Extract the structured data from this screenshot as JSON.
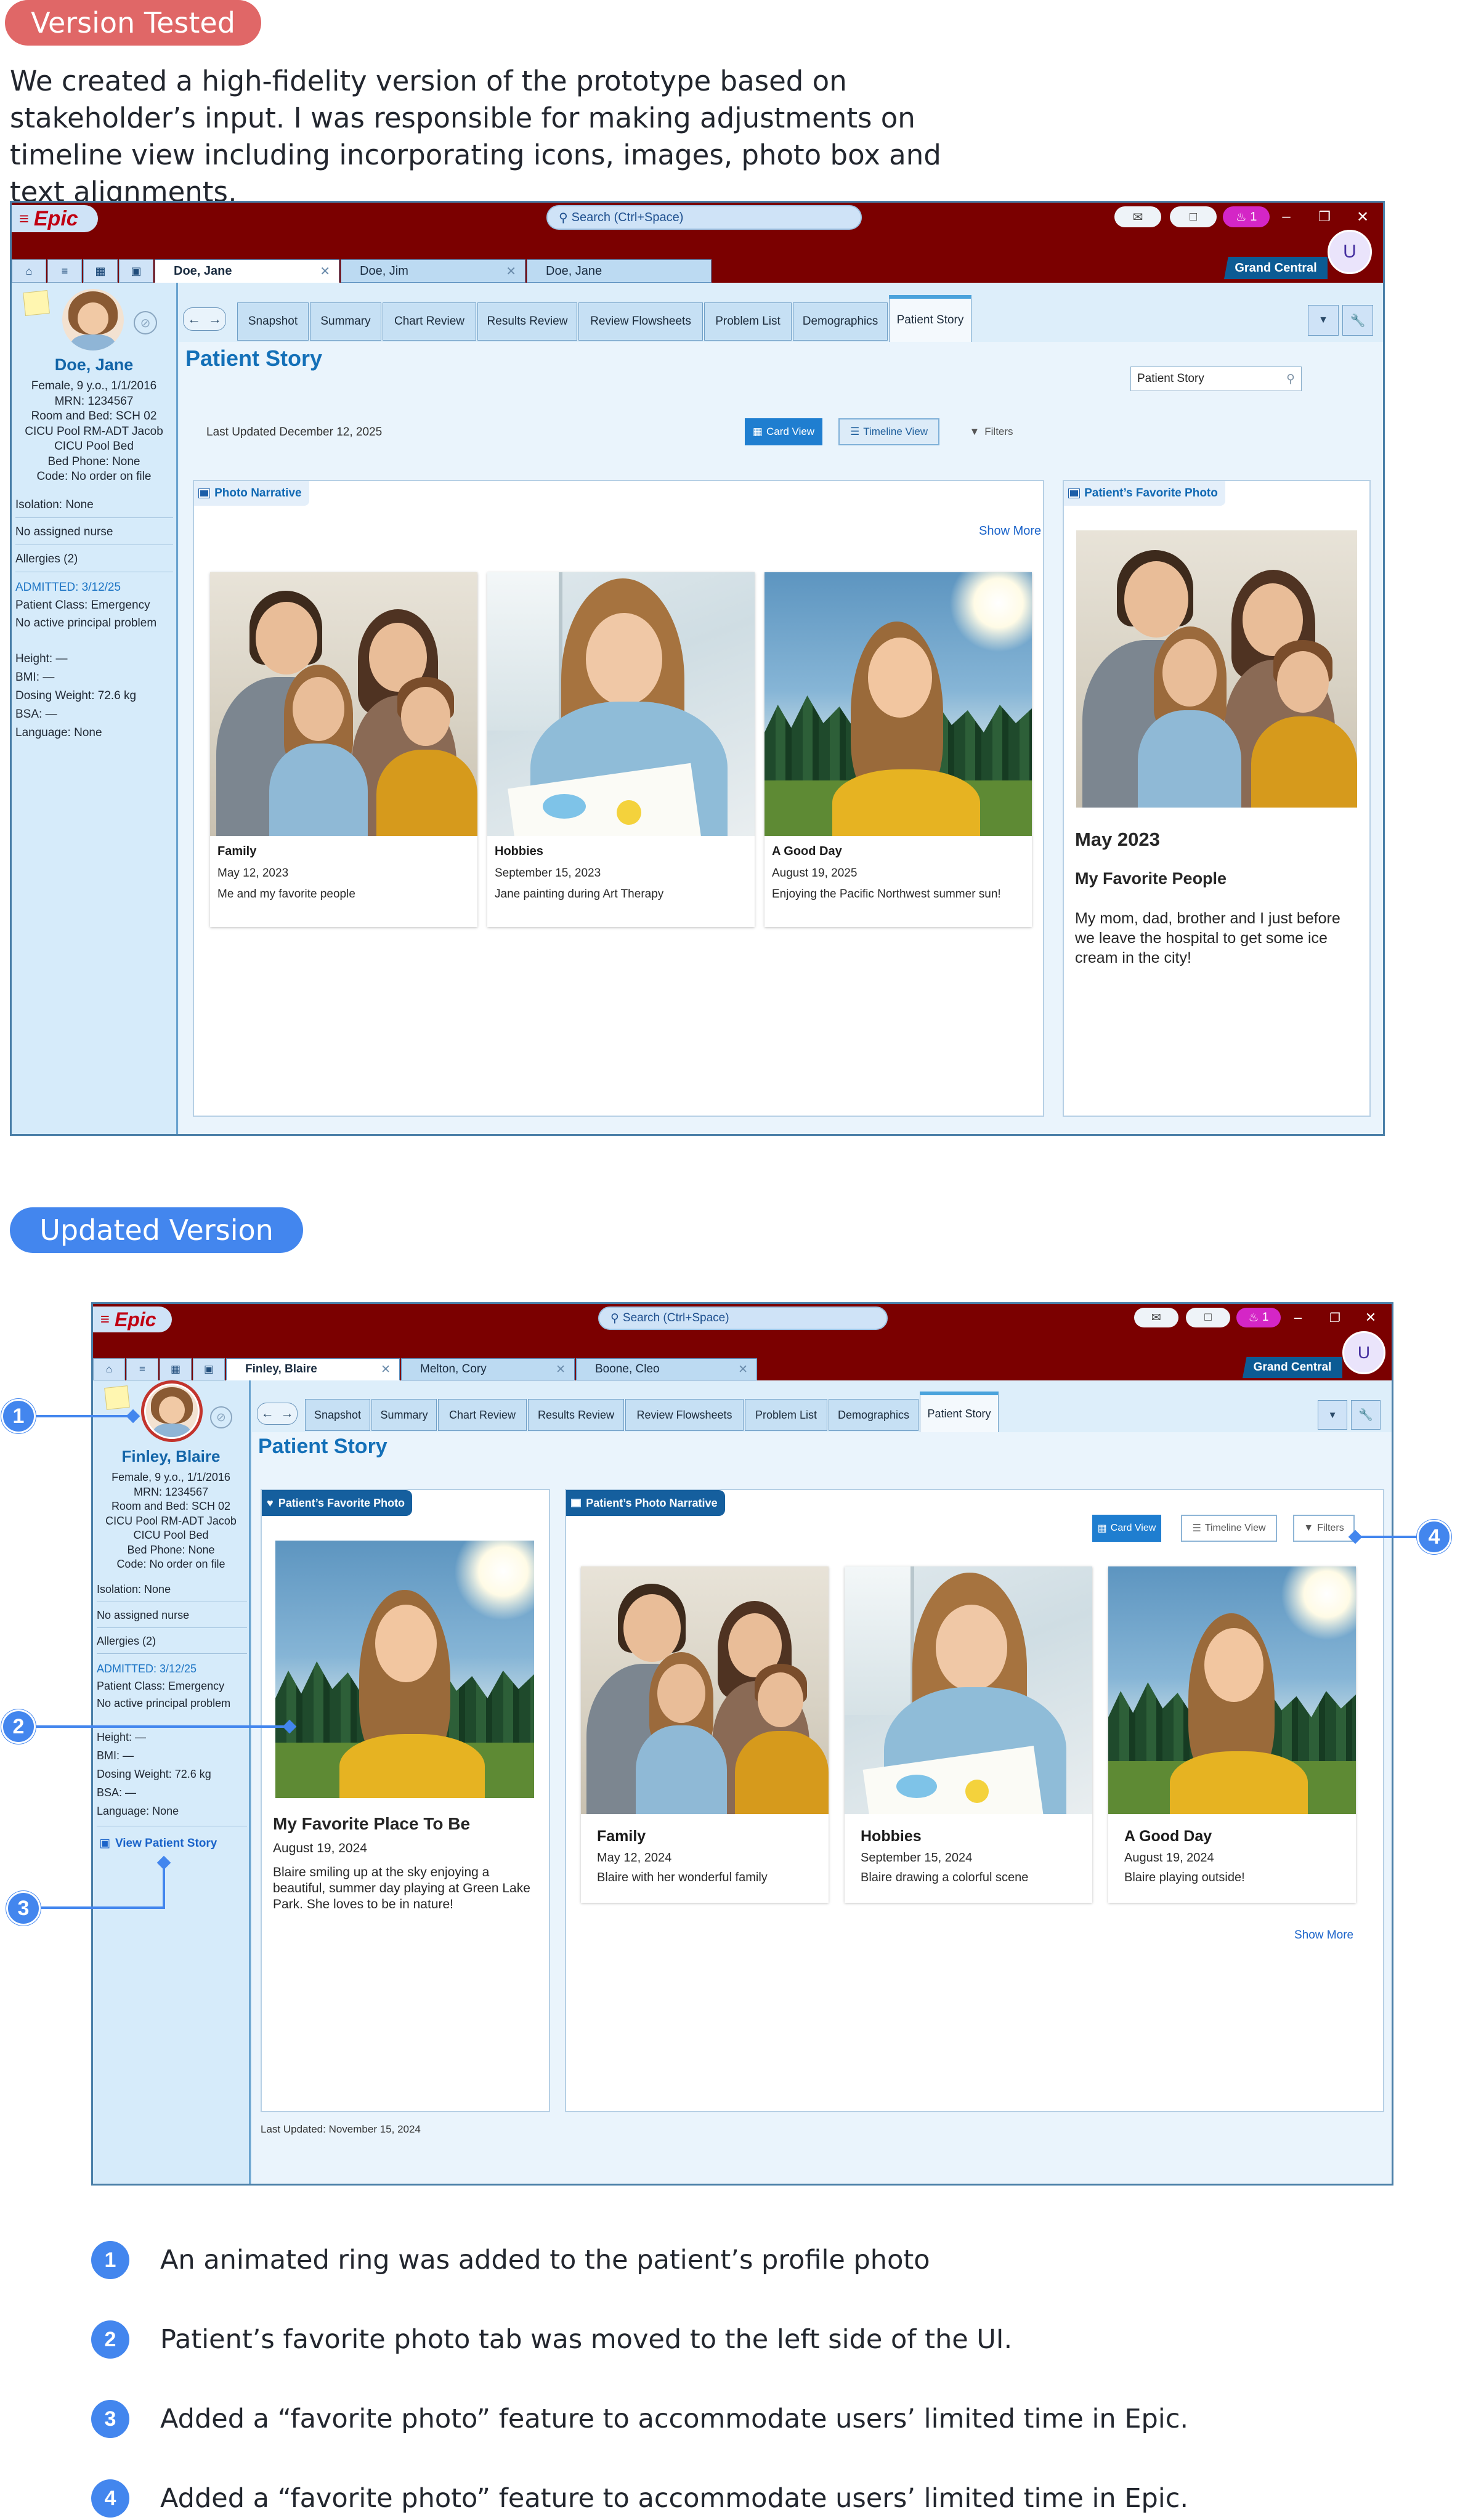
{
  "tested": {
    "label": "Version Tested",
    "intro": "We created a high-fidelity version of the prototype based on stakeholder’s input. I was responsible for making adjustments on timeline view including incorporating icons, images, photo box and text alignments,"
  },
  "updated": {
    "label": "Updated Version"
  },
  "colors": {
    "epic_red": "#7b0000",
    "accent_blue": "#4386ee",
    "tested_red": "#e06767",
    "link_blue": "#1a63c9"
  },
  "common": {
    "logo": "Epic",
    "menu_icon": "≡",
    "search_placeholder": "Search (Ctrl+Space)",
    "bell_count": "1",
    "grand_central": "Grand Central",
    "user_initial": "U",
    "chart_tabs": [
      "Snapshot",
      "Summary",
      "Chart Review",
      "Results Review",
      "Review Flowsheets",
      "Problem List",
      "Demographics",
      "Patient Story"
    ],
    "page_title": "Patient Story",
    "card_view": "Card View",
    "timeline_view": "Timeline View",
    "filters": "Filters"
  },
  "v1": {
    "patient_tabs": [
      "Doe, Jane",
      "Doe, Jim",
      "Doe, Jane"
    ],
    "patient": {
      "name": "Doe, Jane",
      "info": [
        "Female, 9 y.o., 1/1/2016",
        "MRN: 1234567",
        "Room and Bed: SCH 02",
        "CICU Pool RM-ADT Jacob",
        "CICU Pool Bed",
        "Bed Phone: None",
        "Code: No order on file"
      ],
      "rows": [
        "Isolation: None",
        "No assigned nurse",
        "Allergies (2)"
      ],
      "admitted": "ADMITTED: 3/12/25",
      "lines": [
        "Patient Class: Emergency",
        "No active principal problem"
      ],
      "vitals": [
        "Height: —",
        "BMI: —",
        "Dosing Weight: 72.6 kg",
        "BSA: —",
        "Language: None"
      ]
    },
    "search_value": "Patient Story",
    "last_updated": "Last Updated December 12, 2025",
    "narrative_tag": "Photo Narrative",
    "show_more": "Show More",
    "cards": [
      {
        "title": "Family",
        "date": "May 12, 2023",
        "caption": "Me and my favorite people"
      },
      {
        "title": "Hobbies",
        "date": "September 15, 2023",
        "caption": "Jane painting during Art Therapy"
      },
      {
        "title": "A Good Day",
        "date": "August 19, 2025",
        "caption": "Enjoying the Pacific Northwest summer sun!"
      }
    ],
    "favorite": {
      "tag": "Patient’s Favorite Photo",
      "date": "May 2023",
      "title": "My Favorite People",
      "caption": "My mom, dad, brother and I just before we leave the hospital to get some ice cream in the city!"
    }
  },
  "v2": {
    "patient_tabs": [
      "Finley, Blaire",
      "Melton, Cory",
      "Boone, Cleo"
    ],
    "patient": {
      "name": "Finley, Blaire",
      "info": [
        "Female, 9 y.o., 1/1/2016",
        "MRN: 1234567",
        "Room and Bed: SCH 02",
        "CICU Pool RM-ADT Jacob",
        "CICU Pool Bed",
        "Bed Phone: None",
        "Code: No order on file"
      ],
      "rows": [
        "Isolation: None",
        "No assigned nurse",
        "Allergies (2)"
      ],
      "admitted": "ADMITTED: 3/12/25",
      "lines": [
        "Patient Class: Emergency",
        "No active principal problem"
      ],
      "vitals": [
        "Height: —",
        "BMI: —",
        "Dosing Weight: 72.6 kg",
        "BSA: —",
        "Language: None"
      ],
      "view_story": "View Patient Story"
    },
    "favorite": {
      "tag": "Patient’s Favorite Photo",
      "title": "My Favorite Place To Be",
      "date": "August 19, 2024",
      "caption": "Blaire smiling up at the sky enjoying a beautiful, summer day playing at Green Lake Park. She loves to be in nature!"
    },
    "narrative_tag": "Patient’s Photo Narrative",
    "cards": [
      {
        "title": "Family",
        "date": "May 12, 2024",
        "caption": "Blaire with her wonderful family"
      },
      {
        "title": "Hobbies",
        "date": "September 15, 2024",
        "caption": "Blaire drawing a colorful scene"
      },
      {
        "title": "A Good Day",
        "date": "August 19, 2024",
        "caption": "Blaire playing outside!"
      }
    ],
    "show_more": "Show More",
    "last_updated": "Last Updated: November 15, 2024"
  },
  "annotations": [
    {
      "num": "1",
      "text": "An animated ring was added to the patient’s profile photo"
    },
    {
      "num": "2",
      "text": "Patient’s favorite photo tab was moved to the left side of the UI."
    },
    {
      "num": "3",
      "text": "Added a “favorite photo” feature to accommodate users’ limited time in Epic."
    },
    {
      "num": "4",
      "text": "Added a “favorite photo” feature to accommodate users’ limited time in Epic."
    }
  ]
}
